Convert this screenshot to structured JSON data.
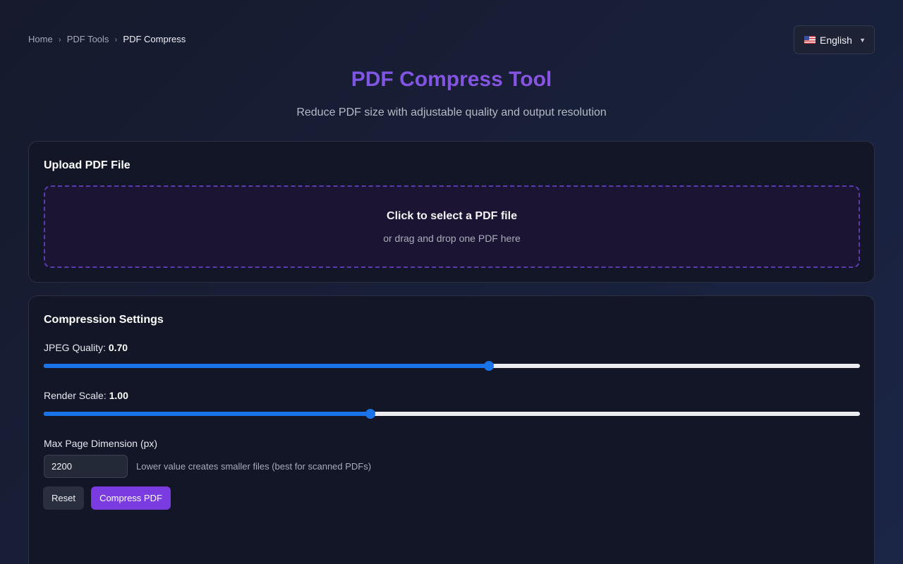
{
  "breadcrumb": {
    "items": [
      "Home",
      "PDF Tools",
      "PDF Compress"
    ],
    "separator": "›"
  },
  "language": {
    "flag_icon": "us-flag-icon",
    "label": "English",
    "caret": "▼"
  },
  "header": {
    "title": "PDF Compress Tool",
    "subtitle": "Reduce PDF size with adjustable quality and output resolution",
    "title_gradient": [
      "#6d5ae6",
      "#9a4fe0"
    ]
  },
  "upload": {
    "card_title": "Upload PDF File",
    "dropzone_title": "Click to select a PDF file",
    "dropzone_subtitle": "or drag and drop one PDF here"
  },
  "settings": {
    "card_title": "Compression Settings",
    "jpeg_quality": {
      "label": "JPEG Quality:",
      "value_text": "0.70",
      "slider_fraction": 0.545
    },
    "render_scale": {
      "label": "Render Scale:",
      "value_text": "1.00",
      "slider_fraction": 0.4
    },
    "max_dimension": {
      "label": "Max Page Dimension (px)",
      "value": "2200",
      "hint": "Lower value creates smaller files (best for scanned PDFs)"
    },
    "buttons": {
      "reset": "Reset",
      "compress": "Compress PDF"
    }
  },
  "colors": {
    "accent": "#7a3be0",
    "slider_fill": "#1a73e8",
    "background": "#161a2c"
  }
}
